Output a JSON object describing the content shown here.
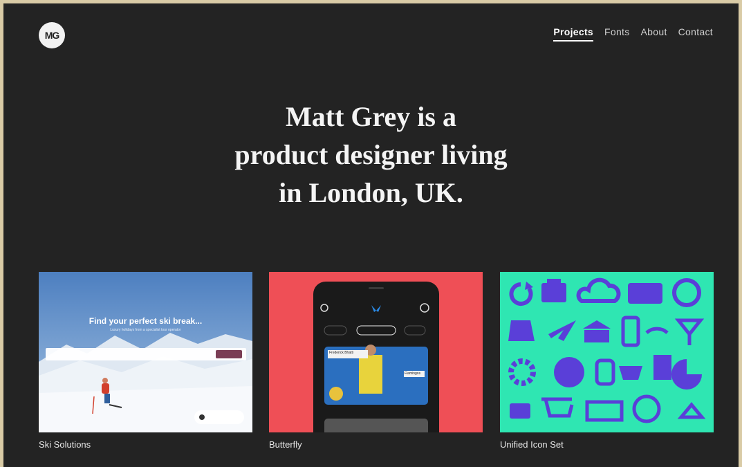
{
  "logo": {
    "text": "MG"
  },
  "nav": {
    "items": [
      {
        "label": "Projects",
        "active": true
      },
      {
        "label": "Fonts",
        "active": false
      },
      {
        "label": "About",
        "active": false
      },
      {
        "label": "Contact",
        "active": false
      }
    ]
  },
  "hero": {
    "line1": "Matt Grey is a",
    "line2": "product designer living",
    "line3": "in London, UK."
  },
  "projects": [
    {
      "title": "Ski Solutions",
      "headline": "Find your perfect ski break...",
      "subline": "Luxury holidays from a specialist tour operator"
    },
    {
      "title": "Butterfly",
      "tag": "Frederick Bhatti",
      "tag2": "Flamingos"
    },
    {
      "title": "Unified Icon Set"
    }
  ],
  "colors": {
    "background": "#232323",
    "border": "#d9cba6",
    "butterfly_bg": "#ef4f56",
    "icons_bg": "#2fe6b2",
    "icons_fg": "#5a3fd8"
  }
}
